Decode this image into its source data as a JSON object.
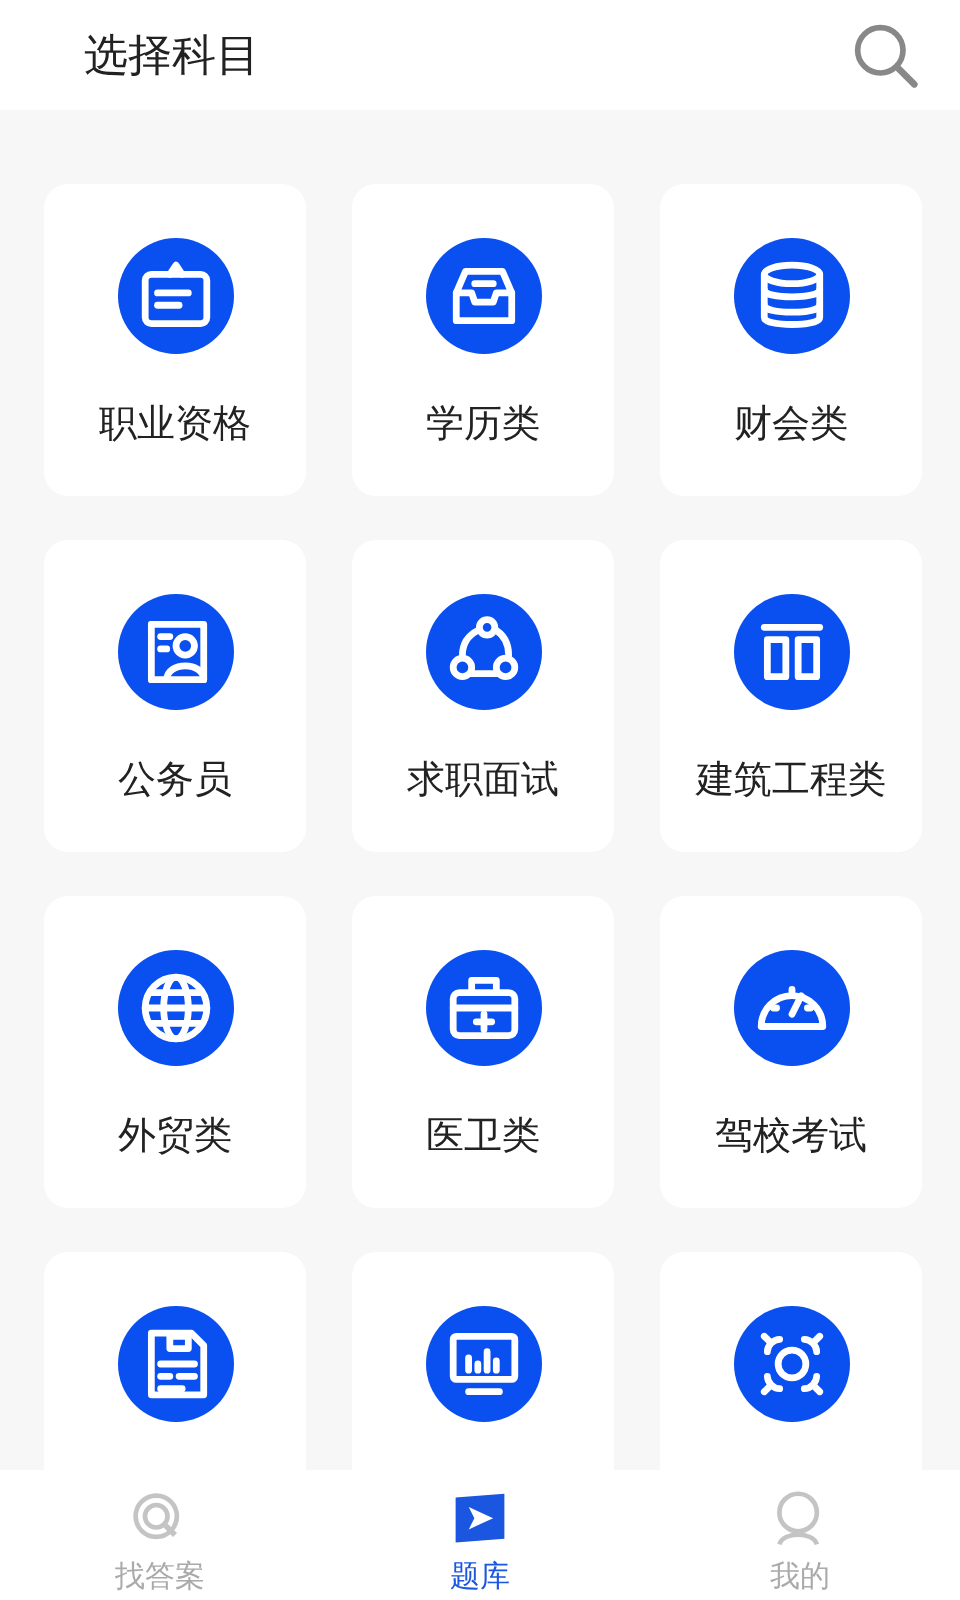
{
  "header": {
    "title": "选择科目"
  },
  "categories": [
    {
      "kind": "full",
      "label": "职业资格"
    },
    {
      "kind": "full",
      "label": "学历类"
    },
    {
      "kind": "full",
      "label": "财会类"
    },
    {
      "kind": "full",
      "label": "公务员"
    },
    {
      "kind": "full",
      "label": "求职面试"
    },
    {
      "kind": "full",
      "label": "建筑工程类"
    },
    {
      "kind": "full",
      "label": "外贸类"
    },
    {
      "kind": "full",
      "label": "医卫类"
    },
    {
      "kind": "full",
      "label": "驾校考试"
    },
    {
      "kind": "partial"
    },
    {
      "kind": "partial"
    },
    {
      "kind": "partial"
    }
  ],
  "tab_bar": [
    {
      "label": "找答案",
      "selected": false
    },
    {
      "label": "题库",
      "selected": true
    },
    {
      "label": "我的",
      "selected": false
    }
  ]
}
